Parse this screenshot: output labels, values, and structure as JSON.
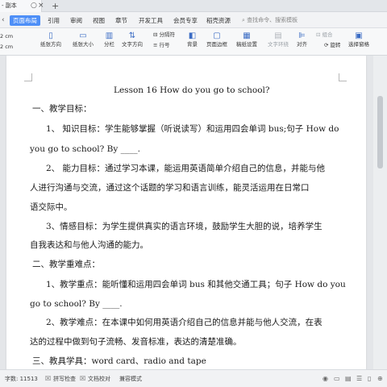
{
  "titlebar": {
    "doc_tab": "- 副本",
    "new_tab": "+"
  },
  "menubar": {
    "items": [
      "页面布局",
      "引用",
      "审阅",
      "视图",
      "章节",
      "开发工具",
      "会员专享",
      "稻壳资源"
    ],
    "search_placeholder": "查找命令、搜索模板"
  },
  "ribbon": {
    "margins": [
      "2 cm",
      "2 cm"
    ],
    "buttons": [
      "纸张方向",
      "纸张大小",
      "分栏",
      "文字方向",
      "分隔符",
      "行号",
      "背景",
      "页面边框",
      "稿纸设置",
      "文字环绕",
      "对齐",
      "旋转",
      "选择窗格"
    ],
    "group_label": "组合"
  },
  "document": {
    "title": "Lesson 16 How do you go to school?",
    "lines": [
      "一、教学目标：",
      "1、 知识目标：学生能够掌握（听说读写）和运用四会单词 bus;句子 How do",
      "you go to school? By ____.",
      "2、 能力目标：通过学习本课，能运用英语简单介绍自己的信息，并能与他",
      "人进行沟通与交流，通过这个话题的学习和语言训练，能灵活运用在日常口",
      "语交际中。",
      "3、情感目标：为学生提供真实的语言环境，鼓励学生大胆的说，培养学生",
      "自我表达和与他人沟通的能力。",
      "二、教学重难点：",
      "1、教学重点：能听懂和运用四会单词 bus 和其他交通工具；句子 How do you",
      "go to school? By ____.",
      "2、教学难点：在本课中如何用英语介绍自己的信息并能与他人交流，在表",
      "达的过程中做到句子流畅、发音标准，表达的清楚准确。",
      "三、教具学具：word card、radio and tape"
    ]
  },
  "statusbar": {
    "word_count": "字数: 11513",
    "spell_check": "拼写检查",
    "doc_proof": "文档校对",
    "compat_mode": "兼容模式"
  },
  "colors": {
    "accent": "#4e8ff7",
    "page": "#ffffff",
    "canvas": "#e4e6e9"
  }
}
